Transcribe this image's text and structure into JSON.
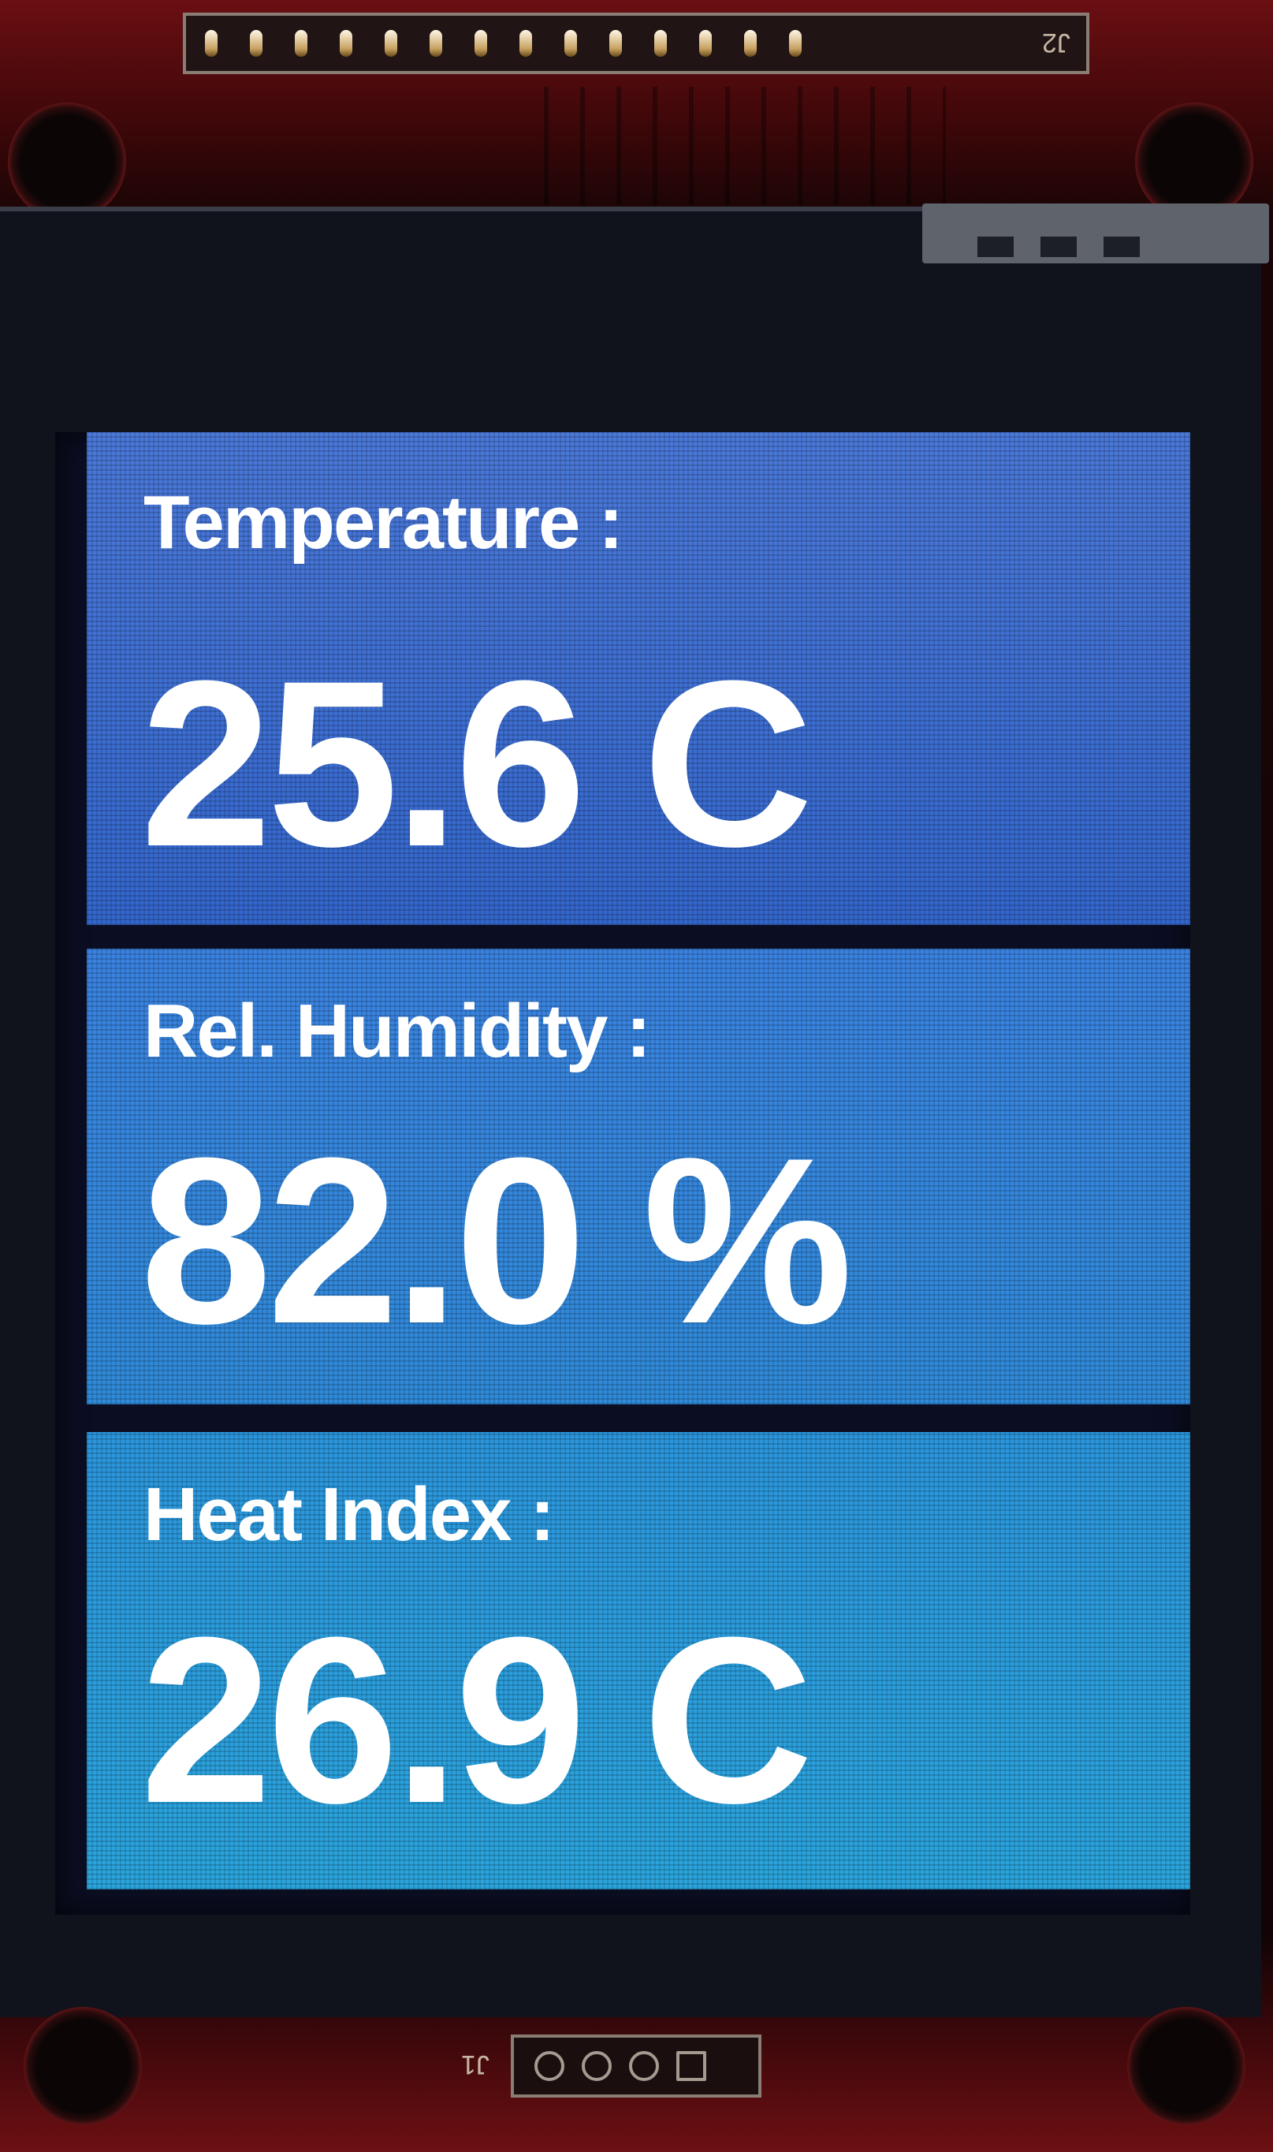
{
  "board": {
    "header_label": "J2",
    "footer_label": "J1"
  },
  "display": {
    "panels": [
      {
        "label": "Temperature :",
        "value": "25.6 C"
      },
      {
        "label": "Rel. Humidity :",
        "value": "82.0 %"
      },
      {
        "label": "Heat Index :",
        "value": "26.9 C"
      }
    ]
  },
  "colors": {
    "panel_top": "#3366cc",
    "panel_middle": "#2f8ad8",
    "panel_bottom": "#2aa4dc",
    "text": "#ffffff",
    "pcb": "#6a0f12"
  }
}
